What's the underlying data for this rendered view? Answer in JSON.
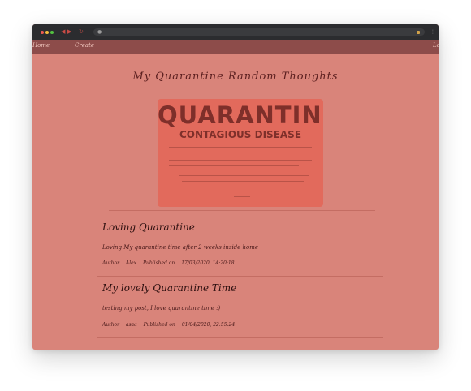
{
  "nav": {
    "home_label": "Home",
    "create_label": "Create",
    "logout_label": "Lo"
  },
  "page": {
    "title": "My Quarantine Random Thoughts"
  },
  "poster": {
    "title": "QUARANTINE",
    "subtitle": "CONTAGIOUS DISEASE"
  },
  "posts": [
    {
      "title": "Loving Quarantine",
      "body": "Loving My quarantine time after 2 weeks inside home",
      "author_label": "Author",
      "author": "Alex",
      "published_label": "Published on",
      "published": "17/03/2020, 14:20:18"
    },
    {
      "title": "My lovely Quarantine Time",
      "body": "testing my post, I love quarantine time :)",
      "author_label": "Author",
      "author": "asaa",
      "published_label": "Published on",
      "published": "01/04/2020, 22:55:24"
    }
  ],
  "colors": {
    "page_bg": "#d9847a",
    "navbar_bg": "#8d4c4a",
    "chrome_bg": "#2b2c2f",
    "title_color": "#5b1f1f"
  }
}
